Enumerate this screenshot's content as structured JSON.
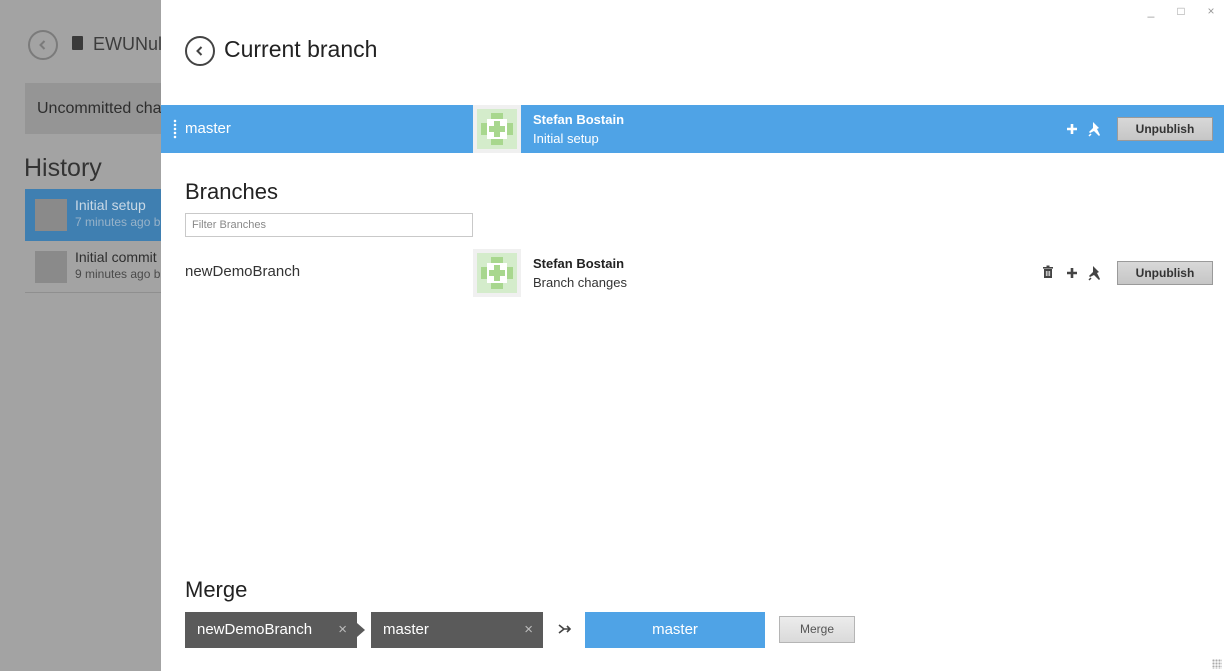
{
  "background": {
    "repo_name": "EWUNul",
    "uncommitted_label": "Uncommitted cha",
    "history_title": "History",
    "history_items": [
      {
        "title": "Initial setup",
        "meta": "7 minutes ago b"
      },
      {
        "title": "Initial commit",
        "meta": "9 minutes ago b"
      }
    ]
  },
  "window": {
    "minimize_glyph": "_",
    "maximize_glyph": "□",
    "close_glyph": "×"
  },
  "header": {
    "title": "Current branch"
  },
  "current_branch": {
    "name": "master",
    "author": "Stefan Bostain",
    "message": "Initial setup",
    "unpublish_label": "Unpublish"
  },
  "branches": {
    "title": "Branches",
    "filter_placeholder": "Filter Branches",
    "filter_value": "",
    "items": [
      {
        "name": "newDemoBranch",
        "author": "Stefan Bostain",
        "message": "Branch changes",
        "unpublish_label": "Unpublish"
      }
    ]
  },
  "merge": {
    "title": "Merge",
    "source": "newDemoBranch",
    "into": "master",
    "target": "master",
    "button_label": "Merge",
    "remove_glyph": "×"
  },
  "colors": {
    "accent": "#4fa3e6",
    "chip": "#5a5a5a",
    "overlay": "#a3a3a3"
  }
}
